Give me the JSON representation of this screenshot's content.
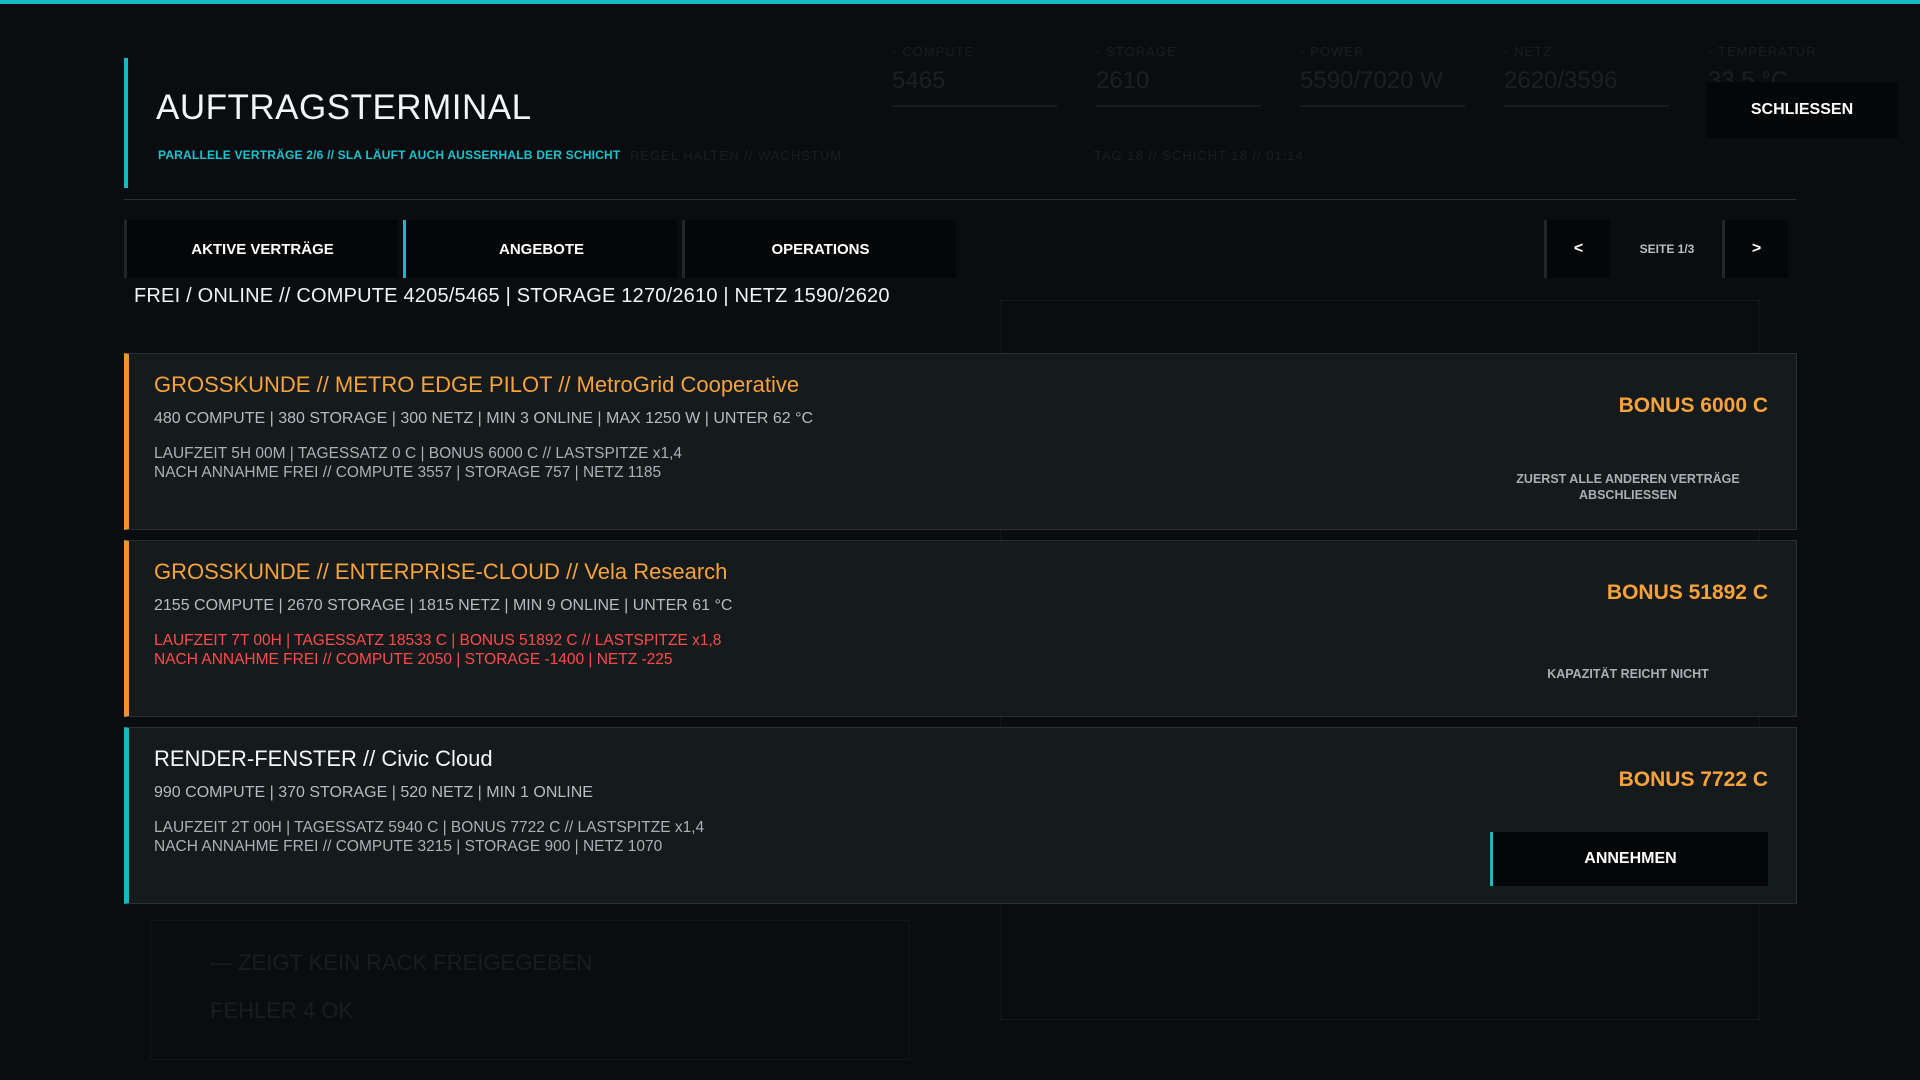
{
  "background": {
    "stats": [
      {
        "label": "◦ COMPUTE",
        "value": "5465"
      },
      {
        "label": "◦ STORAGE",
        "value": "2610"
      },
      {
        "label": "◦ POWER",
        "value": "5590/7020 W"
      },
      {
        "label": "◦ NETZ",
        "value": "2620/3596"
      },
      {
        "label": "◦ TEMPERATUR",
        "value": "33.5 °C"
      }
    ],
    "day_line": "TAG 18  //  SCHICHT 18  //  01:14",
    "left_line": "REGEL HALTEN  //  WACHSTUM",
    "bottom_line_1": "— ZEIGT KEIN RACK FREIGEGEBEN",
    "bottom_line_2": "FEHLER 4 OK"
  },
  "header": {
    "title": "AUFTRAGSTERMINAL",
    "subtitle": "PARALLELE VERTRÄGE 2/6 // SLA LÄUFT AUCH AUSSERHALB DER SCHICHT",
    "close_label": "SCHLIESSEN"
  },
  "tabs": [
    {
      "label": "AKTIVE VERTRÄGE",
      "active": false
    },
    {
      "label": "ANGEBOTE",
      "active": true
    },
    {
      "label": "OPERATIONS",
      "active": false
    }
  ],
  "pager": {
    "prev": "<",
    "label": "SEITE 1/3",
    "next": ">"
  },
  "capacity_line": "FREI / ONLINE  //  COMPUTE 4205/5465  |  STORAGE 1270/2610  |  NETZ 1590/2620",
  "offers": [
    {
      "title": "GROSSKUNDE  //  METRO EDGE PILOT  //  MetroGrid Cooperative",
      "specs": "480 COMPUTE  |  380 STORAGE  |  300 NETZ  |  MIN 3 ONLINE  |  MAX 1250 W  |  UNTER 62 °C",
      "terms": "LAUFZEIT 5H 00M  |  TAGESSATZ 0 C  |  BONUS 6000 C  //  LASTSPITZE x1,4",
      "after": "NACH ANNAHME FREI  //  COMPUTE 3557  |  STORAGE 757  |  NETZ 1185",
      "bonus": "BONUS 6000 C",
      "note": "ZUERST ALLE ANDEREN VERTRÄGE ABSCHLIESSEN",
      "accent": "#f0932e"
    },
    {
      "title": "GROSSKUNDE  //  ENTERPRISE-CLOUD  //  Vela Research",
      "specs": "2155 COMPUTE  |  2670 STORAGE  |  1815 NETZ  |  MIN 9 ONLINE  |  UNTER 61 °C",
      "terms": "LAUFZEIT 7T 00H  |  TAGESSATZ 18533 C  |  BONUS 51892 C  //  LASTSPITZE x1,8",
      "after": "NACH ANNAHME FREI  //  COMPUTE 2050  |  STORAGE -1400  |  NETZ -225",
      "bonus": "BONUS 51892 C",
      "note": "KAPAZITÄT REICHT NICHT",
      "accent": "#f0932e"
    },
    {
      "title": "RENDER-FENSTER  //  Civic Cloud",
      "specs": "990 COMPUTE  |  370 STORAGE  |  520 NETZ  |  MIN 1 ONLINE",
      "terms": "LAUFZEIT 2T 00H  |  TAGESSATZ 5940 C  |  BONUS 7722 C  //  LASTSPITZE x1,4",
      "after": "NACH ANNAHME FREI  //  COMPUTE 3215  |  STORAGE 900  |  NETZ 1070",
      "bonus": "BONUS 7722 C",
      "accept_label": "ANNEHMEN",
      "accent": "#17b9c4"
    }
  ],
  "colors": {
    "accent_cyan": "#17b9c4",
    "accent_orange": "#f0932e",
    "warning_red": "#ff4b4b"
  }
}
